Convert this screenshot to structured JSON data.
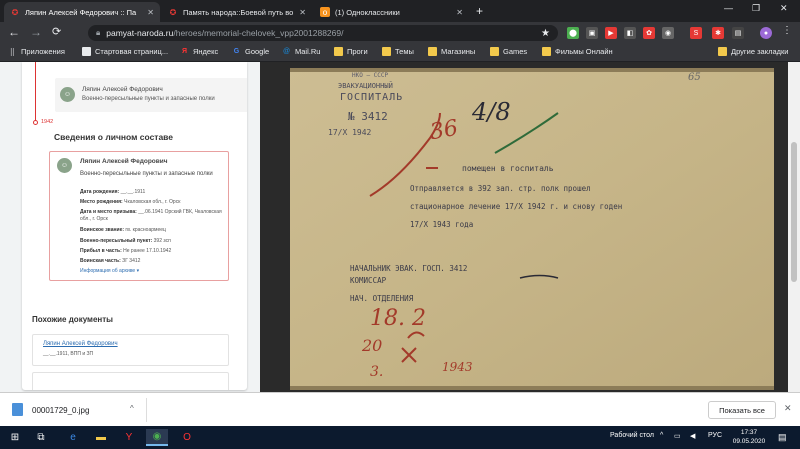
{
  "browser": {
    "tabs": [
      {
        "title": "Ляпин Алексей Федорович :: Па",
        "icon": "star-icon",
        "active": true
      },
      {
        "title": "Память народа::Боевой путь во",
        "icon": "star-icon",
        "active": false
      },
      {
        "title": "(1) Одноклассники",
        "icon": "ok-icon",
        "active": false
      }
    ],
    "new_tab": "+",
    "window_controls": [
      "—",
      "❐",
      "✕"
    ],
    "address": {
      "host": "pamyat-naroda.ru",
      "path": "/heroes/memorial-chelovek_vpp2001288269/"
    },
    "bookmarks": [
      {
        "label": "Приложения",
        "icon": "apps-icon"
      },
      {
        "label": "Стартовая страниц...",
        "icon": "doc-icon"
      },
      {
        "label": "Яндекс",
        "icon": "yandex-icon"
      },
      {
        "label": "Google",
        "icon": "google-icon"
      },
      {
        "label": "Mail.Ru",
        "icon": "mail-icon"
      },
      {
        "label": "Проги",
        "icon": "folder-icon"
      },
      {
        "label": "Темы",
        "icon": "folder-icon"
      },
      {
        "label": "Магазины",
        "icon": "folder-icon"
      },
      {
        "label": "Games",
        "icon": "folder-icon"
      },
      {
        "label": "Фильмы Онлайн",
        "icon": "folder-icon"
      },
      {
        "label": "Другие закладки",
        "icon": "folder-icon"
      }
    ]
  },
  "panel": {
    "top_card": {
      "name": "Ляпин Алексей Федорович",
      "org": "Военно-пересыльные пункты и запасные полки"
    },
    "year": "1942",
    "section_title": "Сведения о личном составе",
    "record": {
      "name": "Ляпин Алексей Федорович",
      "org": "Военно-пересыльные пункты и запасные полки",
      "rows": [
        {
          "label": "Дата рождения:",
          "value": "__.__.1911"
        },
        {
          "label": "Место рождения:",
          "value": "Чкаловская обл., г. Орск"
        },
        {
          "label": "Дата и место призыва:",
          "value": "__.06.1941 Орский ГВК, Чкаловская обл., г. Орск"
        },
        {
          "label": "Воинское звание:",
          "value": "гв. красноармеец"
        },
        {
          "label": "Военно-пересыльный пункт:",
          "value": "392 зсп"
        },
        {
          "label": "Прибыл в часть:",
          "value": "Не ранее 17.10.1942"
        },
        {
          "label": "Воинская часть:",
          "value": "ЗГ 3412"
        }
      ],
      "archive_link": "Информация об архиве ▾"
    },
    "similar_title": "Похожие документы",
    "similar": {
      "link": "Ляпин Алексей Федорович",
      "sub": "__.__.1911, ВПП и ЗП"
    }
  },
  "document_image": {
    "header_lines": [
      "НКО — СССР",
      "ЭВАКУАЦИОННЫЙ",
      "ГОСПИТАЛЬ",
      "№ 3412"
    ],
    "corner_number": "65",
    "dates": [
      "17/X 1942",
      "17/X 1942 г."
    ],
    "typed_text": [
      "помещен в госпиталь",
      "Отправляется в 392 зап. стр. полк прошел",
      "стационарное лечение 17/X 1942 г. и снову годен",
      "17/X 1943 года",
      "НАЧАЛЬНИК ЭВАК. ГОСП. 3412",
      "КОМИССАР",
      "НАЧ. ОТДЕЛЕНИЯ"
    ],
    "handwritten": [
      "4/8",
      "36",
      "18. 2",
      "20",
      "3.",
      "1943"
    ]
  },
  "downloads": {
    "file": "00001729_0.jpg",
    "show_all": "Показать все"
  },
  "taskbar": {
    "desktop_label": "Рабочий стол",
    "lang": "РУС",
    "time": "17:37",
    "date": "09.05.2020"
  }
}
